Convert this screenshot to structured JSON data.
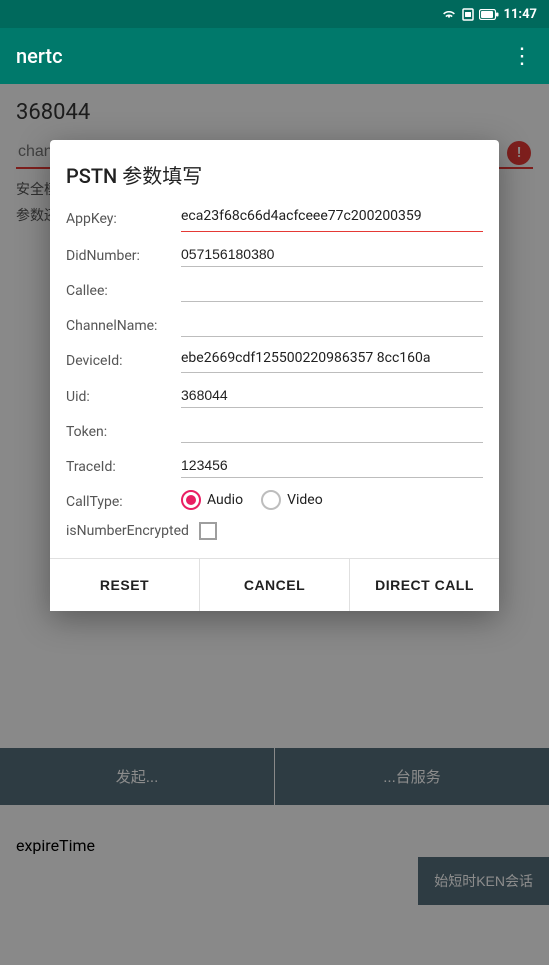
{
  "statusBar": {
    "time": "11:47",
    "icons": [
      "wifi",
      "sim",
      "battery"
    ]
  },
  "appBar": {
    "title": "nertc",
    "menuIcon": "⋮"
  },
  "background": {
    "id": "368044",
    "channelNamePlaceholder": "channelName",
    "safetyModeLabel": "安全模式:",
    "requiredBadge": "Required",
    "restoreParamsLabel": "参数还原:"
  },
  "dialog": {
    "title": "PSTN 参数填写",
    "fields": [
      {
        "label": "AppKey:",
        "value": "eca23f68c66d4acfceee77c200200359",
        "borderRed": true
      },
      {
        "label": "DidNumber:",
        "value": "057156180380",
        "borderRed": false
      },
      {
        "label": "Callee:",
        "value": "",
        "borderRed": false
      },
      {
        "label": "ChannelName:",
        "value": "",
        "borderRed": false
      },
      {
        "label": "DeviceId:",
        "value": "ebe2669cdf125500220986357 8cc160a",
        "borderRed": false
      },
      {
        "label": "Uid:",
        "value": "368044",
        "borderRed": false
      },
      {
        "label": "Token:",
        "value": "",
        "borderRed": false
      },
      {
        "label": "TraceId:",
        "value": "123456",
        "borderRed": false
      }
    ],
    "callType": {
      "label": "CallType:",
      "options": [
        "Audio",
        "Video"
      ],
      "selected": "Audio"
    },
    "isNumberEncrypted": {
      "label": "isNumberEncrypted",
      "checked": false
    },
    "buttons": [
      {
        "id": "reset-button",
        "label": "RESET"
      },
      {
        "id": "cancel-button",
        "label": "CANCEL"
      },
      {
        "id": "direct-call-button",
        "label": "DIRECT CALL"
      }
    ]
  },
  "bgButtons": [
    {
      "id": "launch-button",
      "label": "发起..."
    },
    {
      "id": "service-button",
      "label": "...台服务"
    }
  ],
  "expireLabel": "expireTime",
  "tokenButton": "KEN会话"
}
